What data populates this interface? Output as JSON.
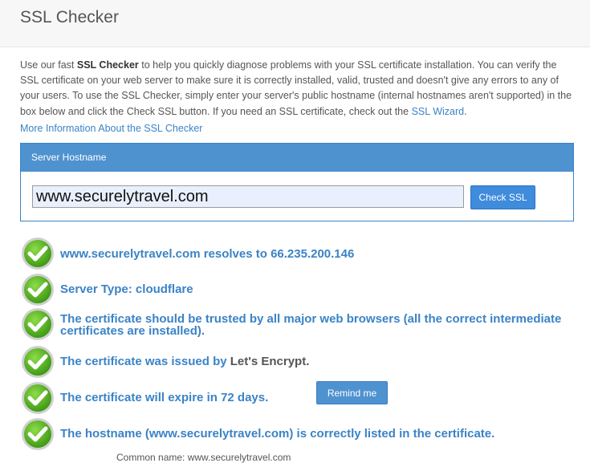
{
  "header": {
    "title": "SSL Checker"
  },
  "intro": {
    "part1": "Use our fast ",
    "bold": "SSL Checker",
    "part2": " to help you quickly diagnose problems with your SSL certificate installation. You can verify the SSL certificate on your web server to make sure it is correctly installed, valid, trusted and doesn't give any errors to any of your users. To use the SSL Checker, simply enter your server's public hostname (internal hostnames aren't supported) in the box below and click the Check SSL button. If you need an SSL certificate, check out the ",
    "wizard_link": "SSL Wizard",
    "part3": "."
  },
  "more_info_link": "More Information About the SSL Checker",
  "panel": {
    "title": "Server Hostname",
    "hostname_value": "www.securelytravel.com",
    "check_button": "Check SSL"
  },
  "results": {
    "r1": "www.securelytravel.com resolves to 66.235.200.146",
    "r2": "Server Type: cloudflare",
    "r3_line1": "The certificate should be trusted by all major web browsers (all the correct intermediate",
    "r3_line2": "certificates are installed).",
    "r4_prefix": "The certificate was issued by ",
    "r4_issuer": "Let's Encrypt",
    "r4_suffix": ".",
    "r5": "The certificate will expire in 72 days.",
    "remind_button": "Remind me",
    "r6": "The hostname (www.securelytravel.com) is correctly listed in the certificate."
  },
  "cut_text": "Common name: www.securelytravel.com",
  "colors": {
    "link": "#3a83c6",
    "panel_header": "#4f92d0",
    "check_green": "#4caf1a"
  },
  "icons": {
    "status": "check-circle-icon"
  }
}
